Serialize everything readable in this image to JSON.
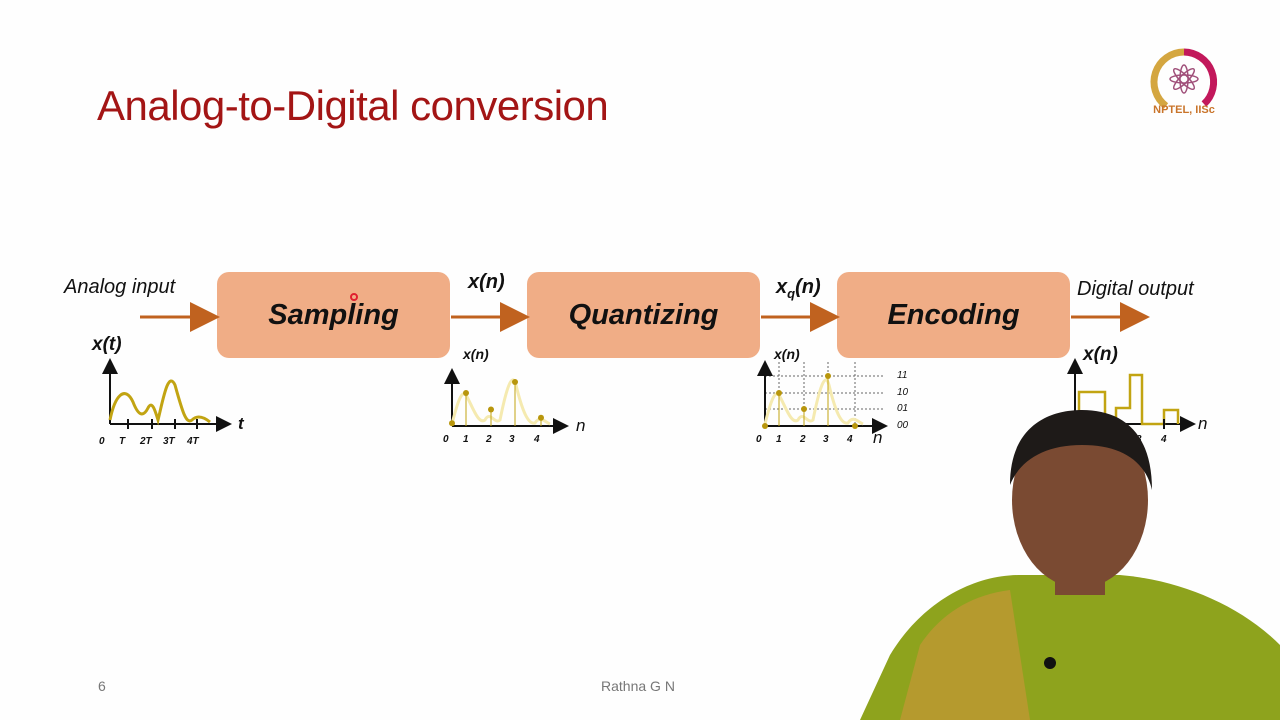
{
  "slide": {
    "title": "Analog-to-Digital conversion",
    "page_number": "6",
    "author": "Rathna G N",
    "logo_text": "NPTEL, IISc"
  },
  "diagram": {
    "input_label": "Analog input",
    "output_label": "Digital output",
    "blocks": [
      {
        "label": "Sampling"
      },
      {
        "label": "Quantizing"
      },
      {
        "label": "Encoding"
      }
    ],
    "edge_labels": {
      "after_sampling": "x(n)",
      "after_quantizing_base": "x",
      "after_quantizing_sub": "q",
      "after_quantizing_tail": "(n)"
    },
    "colors": {
      "block_fill": "#f0ad86",
      "arrow": "#c0621f",
      "signal": "#c2a412",
      "title": "#a31515"
    }
  },
  "plots": {
    "analog": {
      "ylabel": "x(t)",
      "xlabel": "t",
      "ticks": [
        "0",
        "T",
        "2T",
        "3T",
        "4T"
      ]
    },
    "sampled": {
      "ylabel": "x(n)",
      "xlabel": "n",
      "ticks": [
        "0",
        "1",
        "2",
        "3",
        "4"
      ],
      "samples": [
        0.05,
        0.6,
        0.3,
        0.8,
        0.15
      ]
    },
    "quantized": {
      "ylabel": "x(n)",
      "xlabel": "n",
      "ticks": [
        "0",
        "1",
        "2",
        "3",
        "4"
      ],
      "levels": [
        "11",
        "10",
        "01",
        "00"
      ],
      "samples": [
        0,
        2,
        1,
        3,
        0
      ]
    },
    "digital": {
      "ylabel": "x(n)",
      "xlabel": "n",
      "ticks": [
        "3",
        "4"
      ]
    }
  }
}
